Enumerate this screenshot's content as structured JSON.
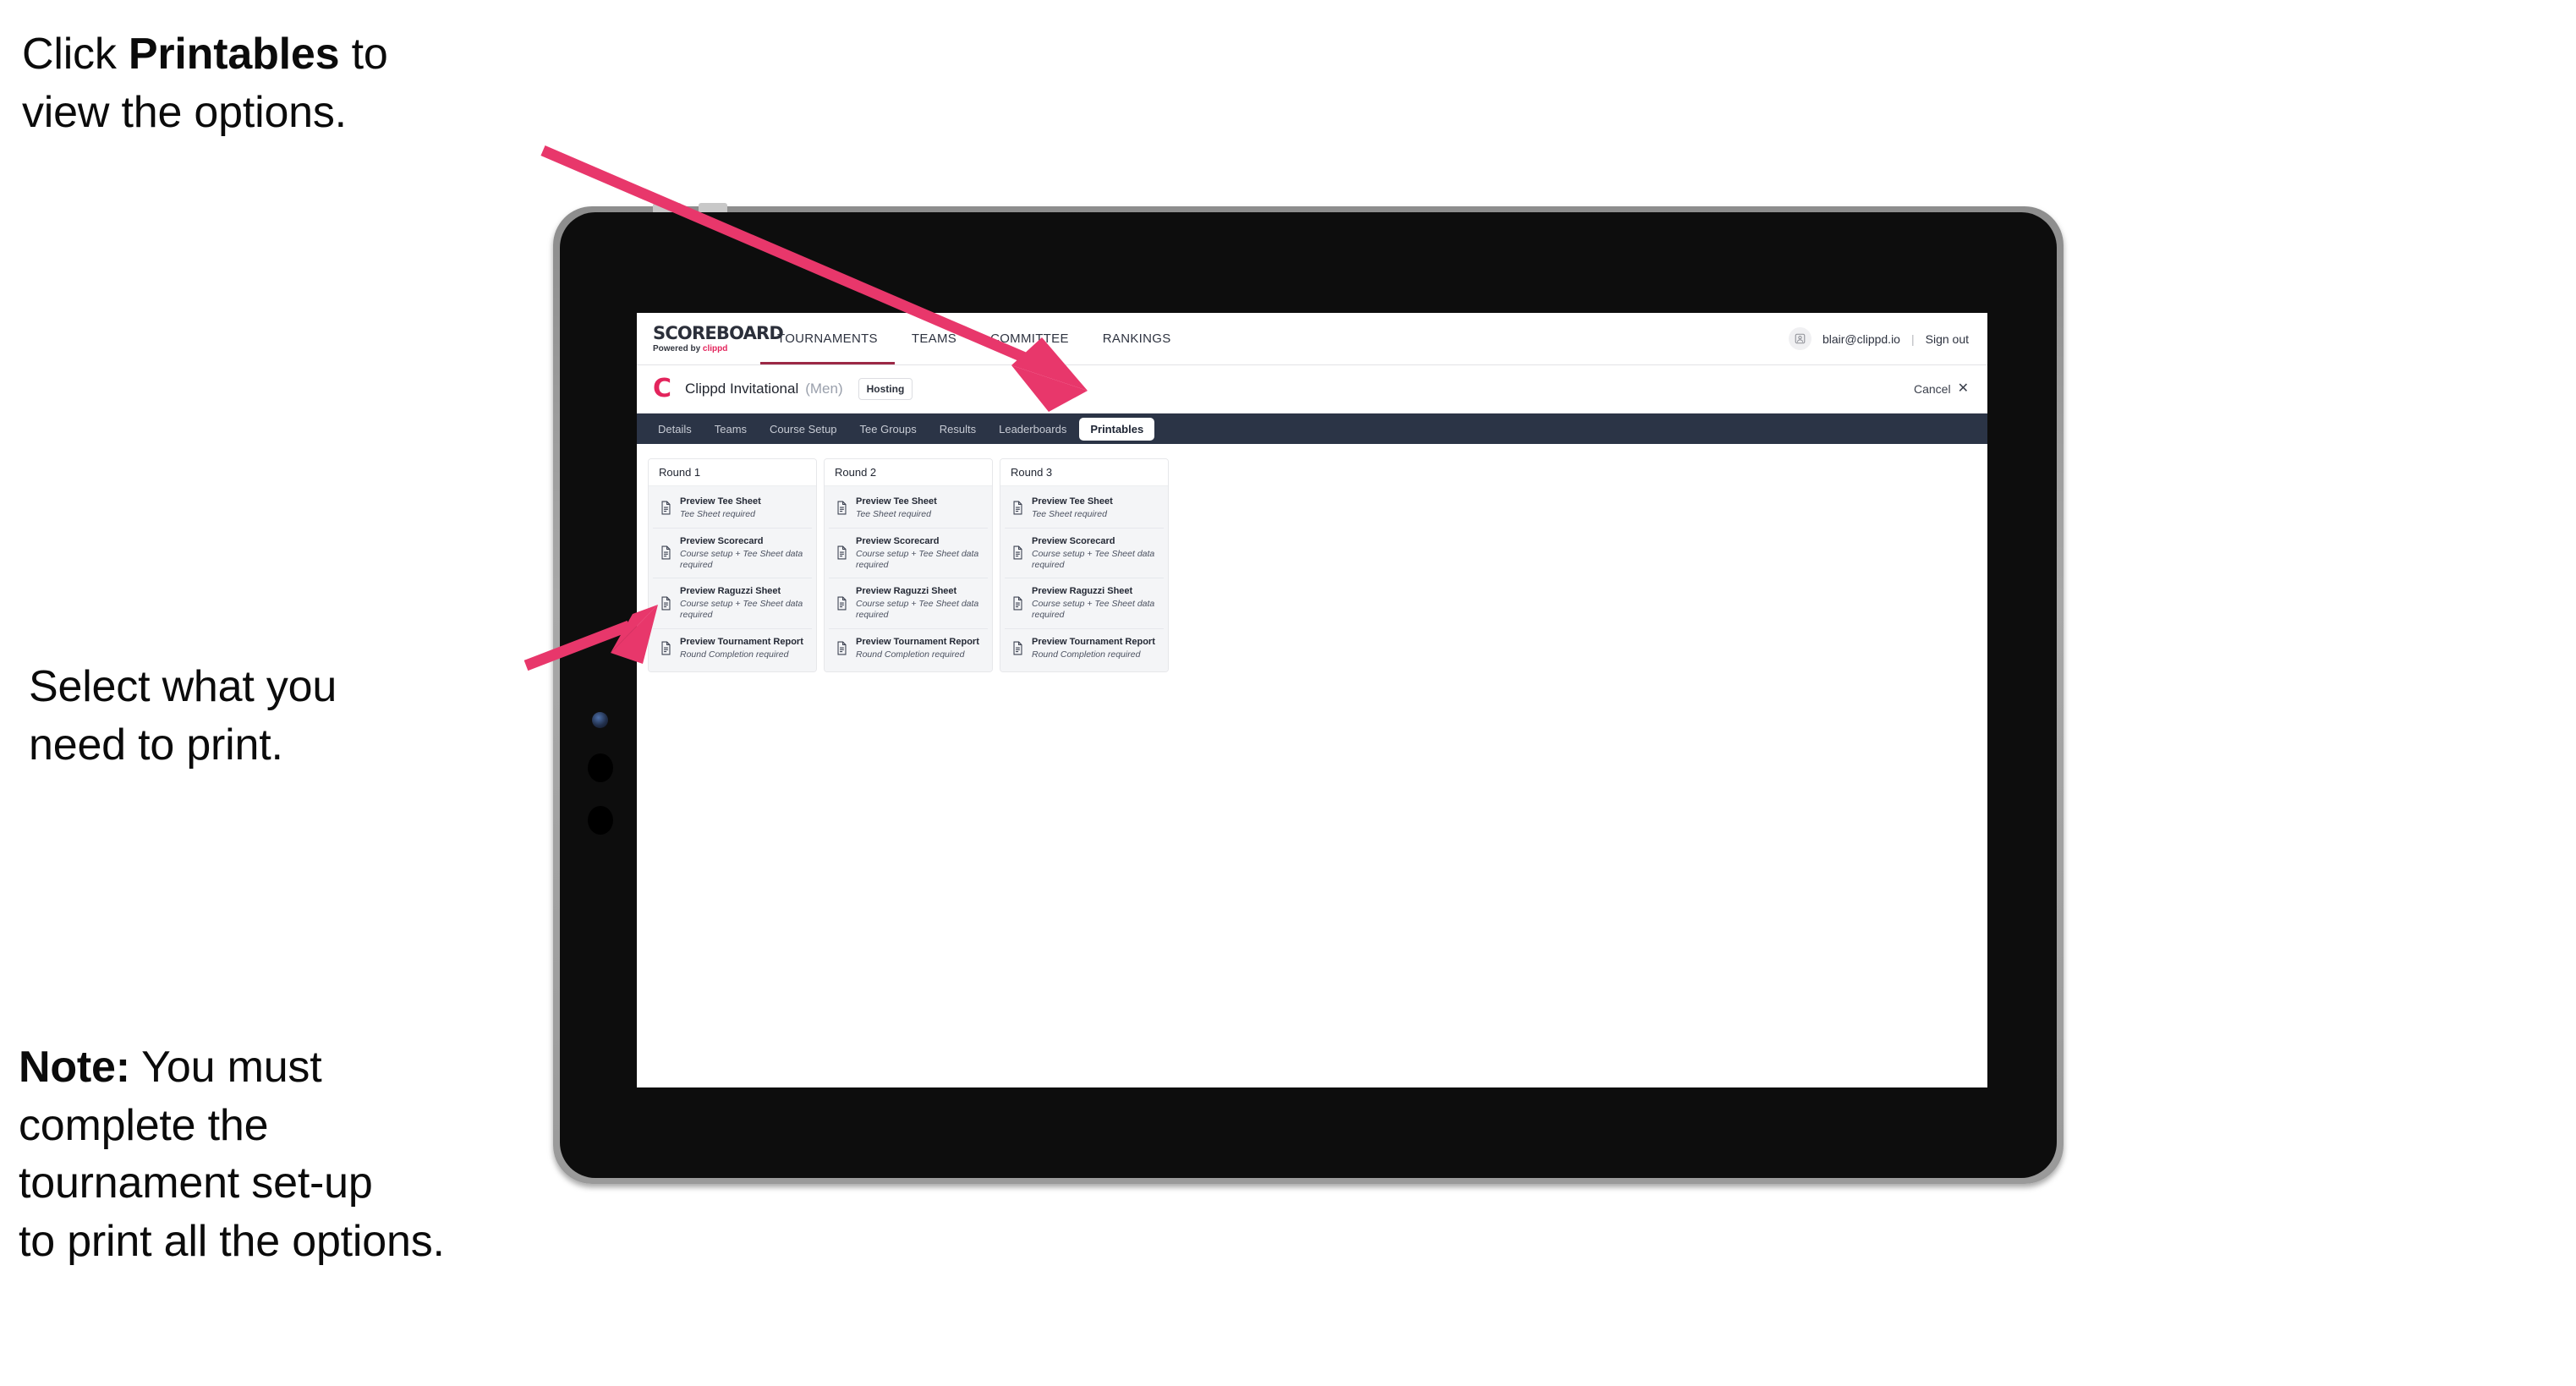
{
  "annotations": {
    "callout_top": {
      "prefix": "Click ",
      "bold": "Printables",
      "suffix": " to\nview the options."
    },
    "callout_mid": {
      "text": "Select what you\n need to print."
    },
    "callout_note": {
      "bold": "Note:",
      "text": " You must\ncomplete the\ntournament set-up\nto print all the options."
    }
  },
  "colors": {
    "accent_pink": "#e8376b",
    "brand_red": "#e3245c",
    "subtab_bar": "#2b3446",
    "active_nav_underline": "#9c2846"
  },
  "app": {
    "brand": {
      "title": "SCOREBOARD",
      "powered_prefix": "Powered by ",
      "powered_name": "clippd"
    },
    "nav": [
      {
        "label": "TOURNAMENTS",
        "active": true
      },
      {
        "label": "TEAMS",
        "active": false
      },
      {
        "label": "COMMITTEE",
        "active": false
      },
      {
        "label": "RANKINGS",
        "active": false
      }
    ],
    "user": {
      "avatar_icon": "user-avatar-icon",
      "email": "blair@clippd.io",
      "separator": "|",
      "sign_out": "Sign out"
    },
    "tournament": {
      "logo_mark": "C",
      "name": "Clippd Invitational",
      "gender": "(Men)",
      "status_badge": "Hosting",
      "cancel_label": "Cancel",
      "cancel_icon": "close-icon"
    },
    "subtabs": [
      {
        "label": "Details",
        "active": false
      },
      {
        "label": "Teams",
        "active": false
      },
      {
        "label": "Course Setup",
        "active": false
      },
      {
        "label": "Tee Groups",
        "active": false
      },
      {
        "label": "Results",
        "active": false
      },
      {
        "label": "Leaderboards",
        "active": false
      },
      {
        "label": "Printables",
        "active": true
      }
    ],
    "rounds": [
      {
        "title": "Round 1",
        "items": [
          {
            "icon": "document-icon",
            "title": "Preview Tee Sheet",
            "sub": "Tee Sheet required"
          },
          {
            "icon": "document-icon",
            "title": "Preview Scorecard",
            "sub": "Course setup + Tee Sheet data required"
          },
          {
            "icon": "document-icon",
            "title": "Preview Raguzzi Sheet",
            "sub": "Course setup + Tee Sheet data required"
          },
          {
            "icon": "document-icon",
            "title": "Preview Tournament Report",
            "sub": "Round Completion required"
          }
        ]
      },
      {
        "title": "Round 2",
        "items": [
          {
            "icon": "document-icon",
            "title": "Preview Tee Sheet",
            "sub": "Tee Sheet required"
          },
          {
            "icon": "document-icon",
            "title": "Preview Scorecard",
            "sub": "Course setup + Tee Sheet data required"
          },
          {
            "icon": "document-icon",
            "title": "Preview Raguzzi Sheet",
            "sub": "Course setup + Tee Sheet data required"
          },
          {
            "icon": "document-icon",
            "title": "Preview Tournament Report",
            "sub": "Round Completion required"
          }
        ]
      },
      {
        "title": "Round 3",
        "items": [
          {
            "icon": "document-icon",
            "title": "Preview Tee Sheet",
            "sub": "Tee Sheet required"
          },
          {
            "icon": "document-icon",
            "title": "Preview Scorecard",
            "sub": "Course setup + Tee Sheet data required"
          },
          {
            "icon": "document-icon",
            "title": "Preview Raguzzi Sheet",
            "sub": "Course setup + Tee Sheet data required"
          },
          {
            "icon": "document-icon",
            "title": "Preview Tournament Report",
            "sub": "Round Completion required"
          }
        ]
      }
    ]
  }
}
